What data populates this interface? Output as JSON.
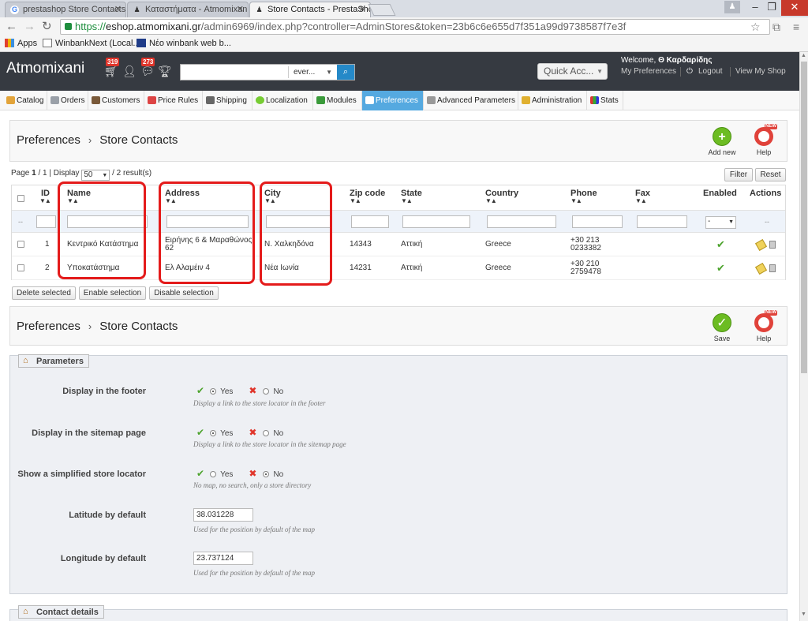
{
  "browser": {
    "tabs": [
      {
        "title": "prestashop Store Contacts",
        "icon": "G"
      },
      {
        "title": "Καταστήματα - Atmomixani",
        "icon": "♟"
      },
      {
        "title": "Store Contacts - PrestaShop",
        "icon": "♟"
      }
    ],
    "url": {
      "scheme": "https://",
      "host": "eshop.atmomixani.gr",
      "path": "/admin6969/index.php?controller=AdminStores&token=23b6c6e655d7f351a99d9738587f7e3f"
    },
    "bookmarks": [
      {
        "label": "Apps"
      },
      {
        "label": "WinbankNext (Local..."
      },
      {
        "label": "Νέο winbank web b..."
      }
    ]
  },
  "header": {
    "shop_name": "Atmomixani",
    "cart_badge": "319",
    "messages_badge": "273",
    "search_scope": "ever...",
    "quick_access": "Quick Acc...",
    "welcome_prefix": "Welcome, ",
    "welcome_name": "Θ Καρδαρίδης",
    "my_preferences": "My Preferences",
    "logout": "Logout",
    "view_shop": "View My Shop"
  },
  "menu": [
    "Catalog",
    "Orders",
    "Customers",
    "Price Rules",
    "Shipping",
    "Localization",
    "Modules",
    "Preferences",
    "Advanced Parameters",
    "Administration",
    "Stats"
  ],
  "panel1": {
    "crumb_parent": "Preferences",
    "crumb_current": "Store Contacts",
    "add_new": "Add new",
    "help": "Help",
    "new_tag": "NEW"
  },
  "list": {
    "page_prefix": "Page ",
    "page_current": "1",
    "page_rest": " / 1 | Display ",
    "display_value": "50",
    "results": " / 2 result(s)",
    "filter_button": "Filter",
    "reset_button": "Reset",
    "columns": {
      "id": "ID",
      "name": "Name",
      "address": "Address",
      "city": "City",
      "zip": "Zip code",
      "state": "State",
      "country": "Country",
      "phone": "Phone",
      "fax": "Fax",
      "enabled": "Enabled",
      "actions": "Actions"
    },
    "filter_enabled": "-",
    "filter_dash": "--",
    "rows": [
      {
        "id": "1",
        "name": "Κεντρικό Κατάστημα",
        "address_l1": "Ειρήνης 6 & Μαραθώνος",
        "address_l2": "62",
        "city": "Ν. Χαλκηδόνα",
        "zip": "14343",
        "state": "Αττική",
        "country": "Greece",
        "phone_l1": "+30 213",
        "phone_l2": "0233382",
        "fax": ""
      },
      {
        "id": "2",
        "name": "Υποκατάστημα",
        "address_l1": "Ελ Αλαμέιν 4",
        "address_l2": "",
        "city": "Νέα Ιωνία",
        "zip": "14231",
        "state": "Αττική",
        "country": "Greece",
        "phone_l1": "+30 210",
        "phone_l2": "2759478",
        "fax": ""
      }
    ],
    "bulk": {
      "delete": "Delete selected",
      "enable": "Enable selection",
      "disable": "Disable selection"
    }
  },
  "panel2": {
    "crumb_parent": "Preferences",
    "crumb_current": "Store Contacts",
    "save": "Save",
    "help": "Help",
    "new_tag": "NEW"
  },
  "form": {
    "legend": "Parameters",
    "footer": {
      "label": "Display in the footer",
      "yes": "Yes",
      "no": "No",
      "hint": "Display a link to the store locator in the footer"
    },
    "sitemap": {
      "label": "Display in the sitemap page",
      "yes": "Yes",
      "no": "No",
      "hint": "Display a link to the store locator in the sitemap page"
    },
    "simplified": {
      "label": "Show a simplified store locator",
      "yes": "Yes",
      "no": "No",
      "hint": "No map, no search, only a store directory"
    },
    "latitude": {
      "label": "Latitude by default",
      "value": "38.031228",
      "hint": "Used for the position by default of the map"
    },
    "longitude": {
      "label": "Longitude by default",
      "value": "23.737124",
      "hint": "Used for the position by default of the map"
    },
    "contact_legend": "Contact details"
  },
  "colors": {
    "accent": "#55a9e0",
    "header_bg": "#363a41",
    "badge": "#e0352b",
    "highlight": "#e41b1b",
    "check": "#4ca32c"
  }
}
